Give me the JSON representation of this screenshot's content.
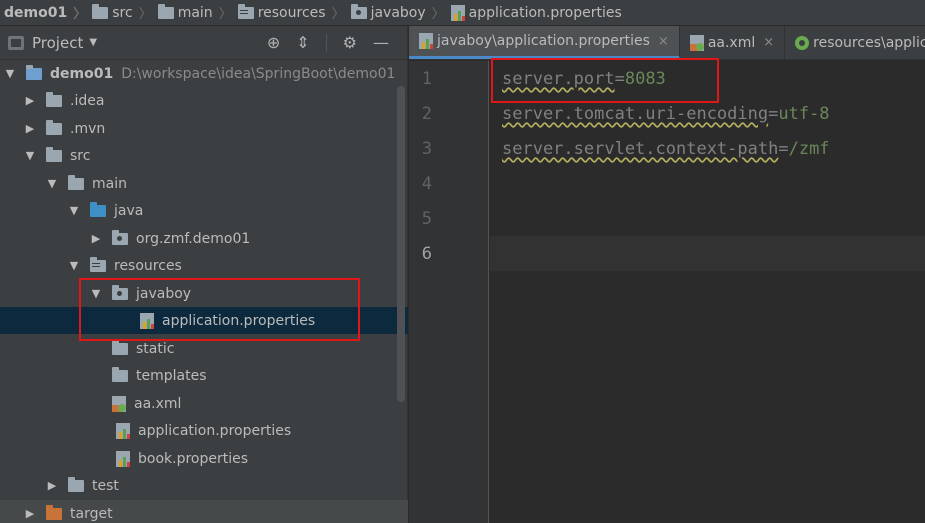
{
  "breadcrumb": {
    "items": [
      {
        "label": "demo01",
        "icon": "none"
      },
      {
        "label": "src",
        "icon": "folder-icon"
      },
      {
        "label": "main",
        "icon": "folder-icon"
      },
      {
        "label": "resources",
        "icon": "resources-folder-icon"
      },
      {
        "label": "javaboy",
        "icon": "package-folder-icon"
      },
      {
        "label": "application.properties",
        "icon": "properties-file-icon"
      }
    ]
  },
  "project_panel": {
    "title": "Project",
    "tree": [
      {
        "label": "demo01",
        "path": "D:\\workspace\\idea\\SpringBoot\\demo01",
        "expanded": true,
        "depth": 0
      },
      {
        "label": ".idea",
        "expanded": false,
        "depth": 1
      },
      {
        "label": ".mvn",
        "expanded": false,
        "depth": 1
      },
      {
        "label": "src",
        "expanded": true,
        "depth": 1
      },
      {
        "label": "main",
        "expanded": true,
        "depth": 2
      },
      {
        "label": "java",
        "expanded": true,
        "depth": 3
      },
      {
        "label": "org.zmf.demo01",
        "expanded": false,
        "depth": 4
      },
      {
        "label": "resources",
        "expanded": true,
        "depth": 3
      },
      {
        "label": "javaboy",
        "expanded": true,
        "depth": 4
      },
      {
        "label": "application.properties",
        "depth": 5,
        "selected": true
      },
      {
        "label": "static",
        "depth": 4
      },
      {
        "label": "templates",
        "depth": 4
      },
      {
        "label": "aa.xml",
        "depth": 4
      },
      {
        "label": "application.properties",
        "depth": 4
      },
      {
        "label": "book.properties",
        "depth": 4
      },
      {
        "label": "test",
        "expanded": false,
        "depth": 2
      },
      {
        "label": "target",
        "expanded": false,
        "depth": 1
      }
    ]
  },
  "editor": {
    "tabs": [
      {
        "label": "javaboy\\application.properties",
        "active": true
      },
      {
        "label": "aa.xml",
        "active": false
      },
      {
        "label": "resources\\applicatio",
        "active": false
      }
    ],
    "line_numbers": [
      "1",
      "2",
      "3",
      "4",
      "5",
      "6"
    ],
    "current_line": 6,
    "lines": [
      {
        "key": "server.port",
        "eq": "=",
        "value": "8083"
      },
      {
        "key": "server.tomcat.uri-encoding",
        "eq": "=",
        "value": "utf-8"
      },
      {
        "key": "server.servlet.context-path",
        "eq": "=",
        "value": "/zmf"
      }
    ]
  },
  "colors": {
    "highlight_box": "#e11717",
    "selection": "#0d293e",
    "panel_bg": "#3c3f41",
    "editor_bg": "#2b2b2b",
    "string_value": "#6a8759"
  }
}
